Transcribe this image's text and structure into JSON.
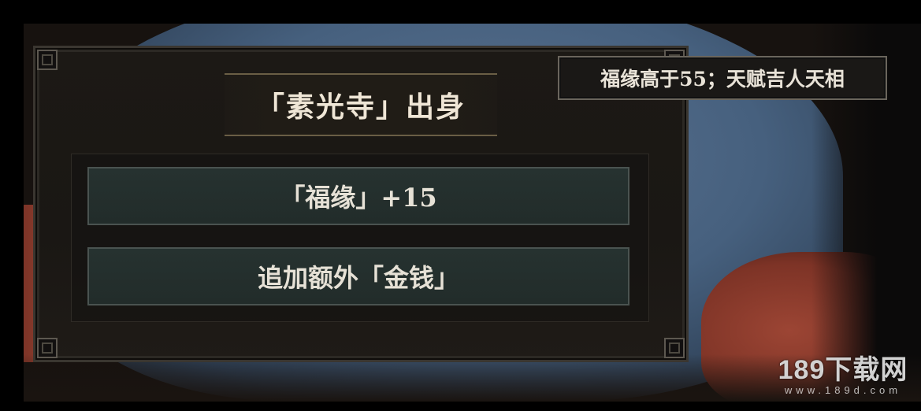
{
  "dialog": {
    "title": "「素光寺」出身",
    "options": [
      {
        "label": "「福缘」+15"
      },
      {
        "label": "追加额外「金钱」"
      }
    ]
  },
  "tooltip": {
    "text": "福缘高于55；天赋吉人天相"
  },
  "watermark": {
    "name": "189下载网",
    "url": "www.189d.com"
  },
  "colors": {
    "panel_bg": "#1c1915",
    "option_bg": "#263230",
    "title_border": "#6a5e45",
    "text": "#efe6d6"
  }
}
